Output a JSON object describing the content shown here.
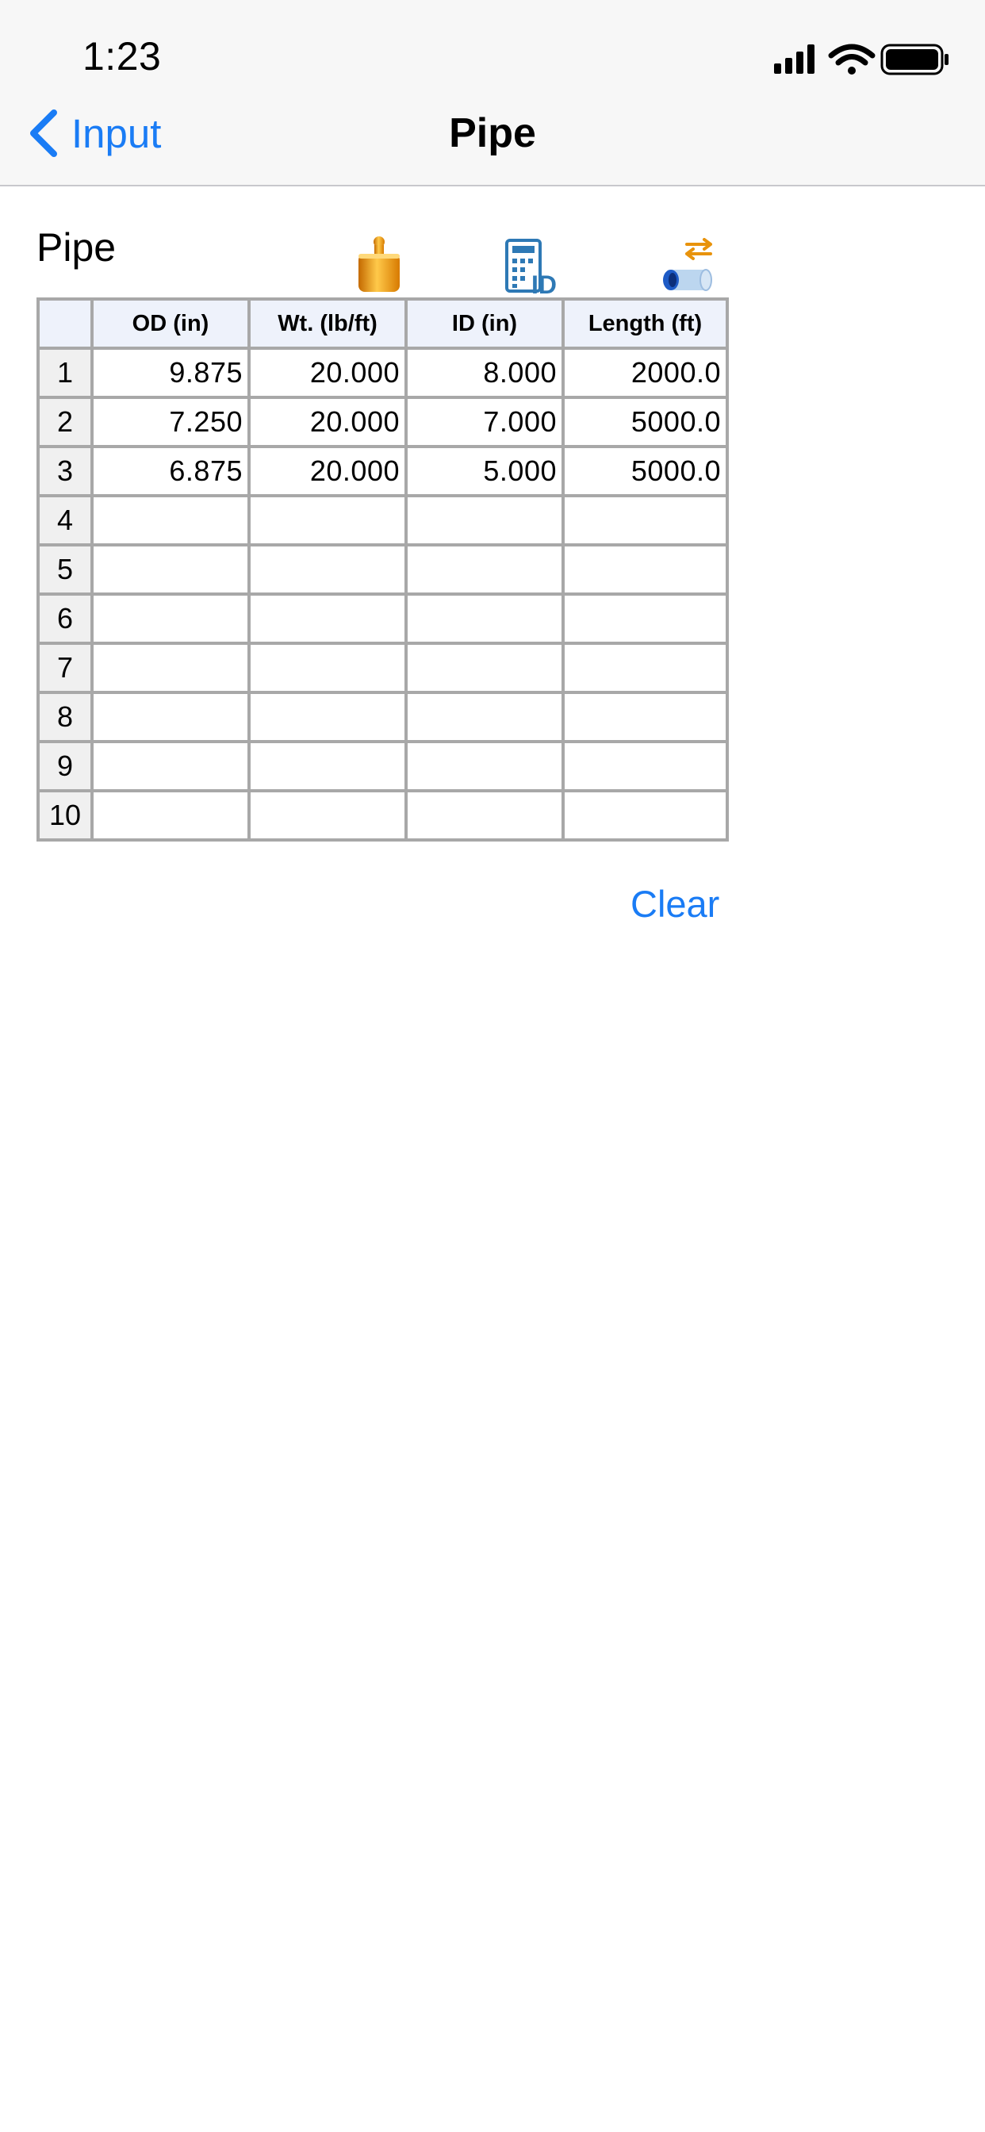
{
  "status_bar": {
    "time": "1:23",
    "icons": [
      "cellular-signal-icon",
      "wifi-icon",
      "battery-icon"
    ]
  },
  "nav": {
    "back_label": "Input",
    "title": "Pipe"
  },
  "section": {
    "title": "Pipe",
    "tools": [
      "weight-icon",
      "id-calculator-icon",
      "pipe-swap-icon"
    ]
  },
  "table": {
    "headers": [
      "",
      "OD (in)",
      "Wt. (lb/ft)",
      "ID (in)",
      "Length (ft)"
    ],
    "rows": [
      {
        "n": "1",
        "od": "9.875",
        "wt": "20.000",
        "id": "8.000",
        "len": "2000.0"
      },
      {
        "n": "2",
        "od": "7.250",
        "wt": "20.000",
        "id": "7.000",
        "len": "5000.0"
      },
      {
        "n": "3",
        "od": "6.875",
        "wt": "20.000",
        "id": "5.000",
        "len": "5000.0"
      },
      {
        "n": "4",
        "od": "",
        "wt": "",
        "id": "",
        "len": ""
      },
      {
        "n": "5",
        "od": "",
        "wt": "",
        "id": "",
        "len": ""
      },
      {
        "n": "6",
        "od": "",
        "wt": "",
        "id": "",
        "len": ""
      },
      {
        "n": "7",
        "od": "",
        "wt": "",
        "id": "",
        "len": ""
      },
      {
        "n": "8",
        "od": "",
        "wt": "",
        "id": "",
        "len": ""
      },
      {
        "n": "9",
        "od": "",
        "wt": "",
        "id": "",
        "len": ""
      },
      {
        "n": "10",
        "od": "",
        "wt": "",
        "id": "",
        "len": ""
      }
    ]
  },
  "actions": {
    "clear_label": "Clear"
  },
  "colors": {
    "accent": "#1a7cf5",
    "header_bg": "#eef2fb",
    "grid_border": "#a8a8a8",
    "rownum_bg": "#f0f0f0"
  }
}
